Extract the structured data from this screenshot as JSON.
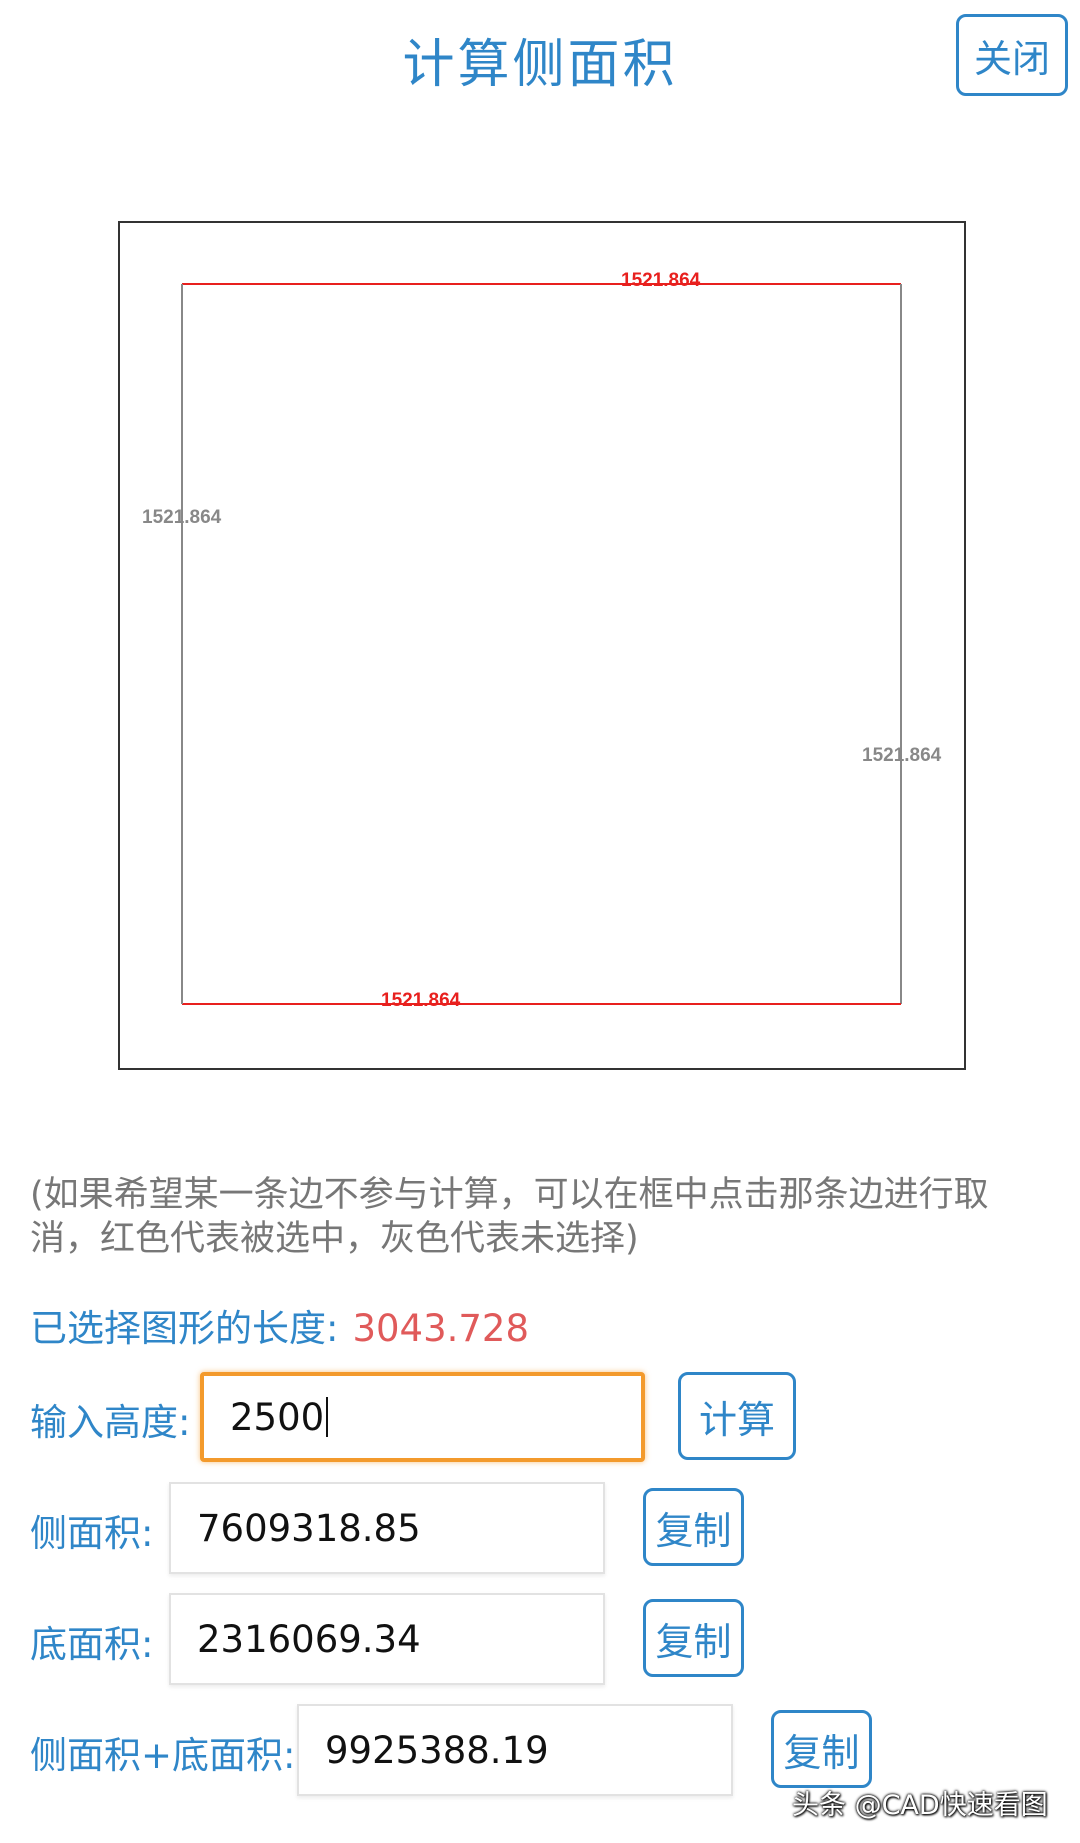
{
  "header": {
    "title": "计算侧面积",
    "close_label": "关闭"
  },
  "canvas": {
    "edges": {
      "top": {
        "label": "1521.864",
        "selected": true
      },
      "right": {
        "label": "1521.864",
        "selected": false
      },
      "bottom": {
        "label": "1521.864",
        "selected": true
      },
      "left": {
        "label": "1521.864",
        "selected": false
      }
    },
    "selected_color": "#e8201e",
    "unselected_color": "#888888"
  },
  "hint": "(如果希望某一条边不参与计算，可以在框中点击那条边进行取消，红色代表被选中，灰色代表未选择)",
  "selected_length": {
    "label": "已选择图形的长度:",
    "value": "3043.728"
  },
  "height_input": {
    "label": "输入高度:",
    "value": "2500",
    "button": "计算"
  },
  "side_area": {
    "label": "侧面积:",
    "value": "7609318.85",
    "button": "复制"
  },
  "bottom_area": {
    "label": "底面积:",
    "value": "2316069.34",
    "button": "复制"
  },
  "total_area": {
    "label": "侧面积+底面积:",
    "value": "9925388.19",
    "button": "复制"
  },
  "watermark": "头条 @CAD快速看图",
  "colors": {
    "accent": "#2f86c8",
    "value_red": "#e05a5a",
    "focus_orange": "#f39a2c",
    "hint_gray": "#777777"
  }
}
